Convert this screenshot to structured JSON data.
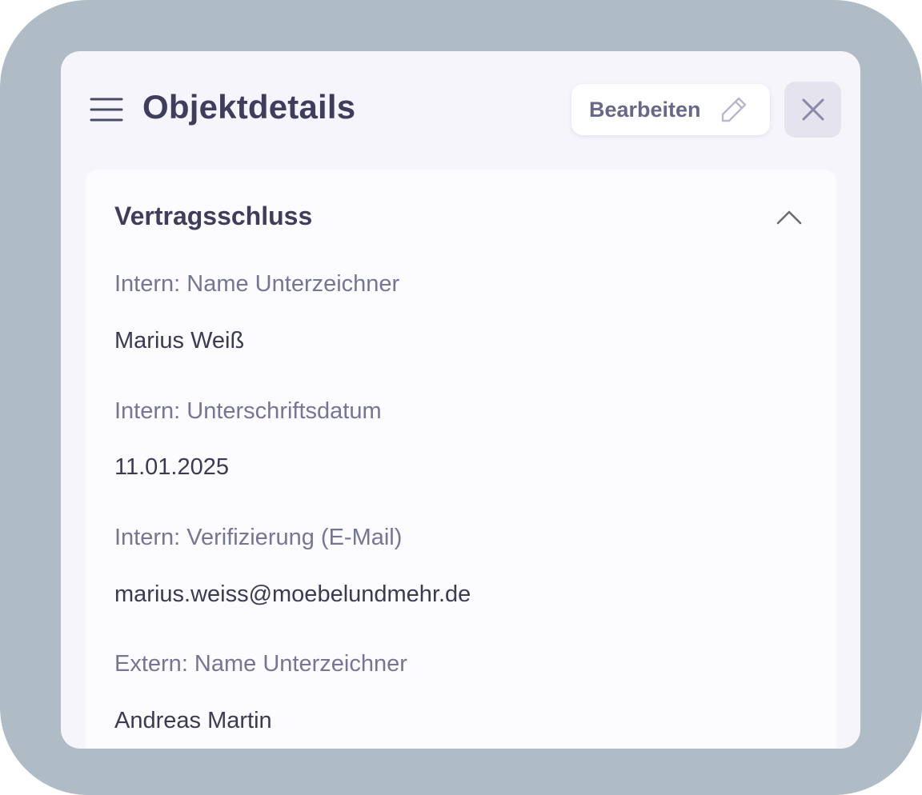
{
  "header": {
    "title": "Objektdetails",
    "edit_label": "Bearbeiten"
  },
  "icons": {
    "menu": "hamburger-menu-icon",
    "edit": "pencil-icon",
    "close": "close-x-icon",
    "collapse": "chevron-up-icon"
  },
  "section": {
    "title": "Vertragsschluss",
    "fields": [
      {
        "label": "Intern: Name Unterzeichner",
        "value": "Marius Weiß"
      },
      {
        "label": "Intern: Unterschriftsdatum",
        "value": "11.01.2025"
      },
      {
        "label": "Intern: Verifizierung (E-Mail)",
        "value": "marius.weiss@moebelundmehr.de"
      },
      {
        "label": "Extern: Name Unterzeichner",
        "value": "Andreas Martin"
      }
    ]
  },
  "colors": {
    "backdrop": "#b0bcc5",
    "panel": "#f6f5fc",
    "card": "#fcfcfe",
    "title_text": "#3f3d5c",
    "label_text": "#757597",
    "value_text": "#3a3a54"
  }
}
